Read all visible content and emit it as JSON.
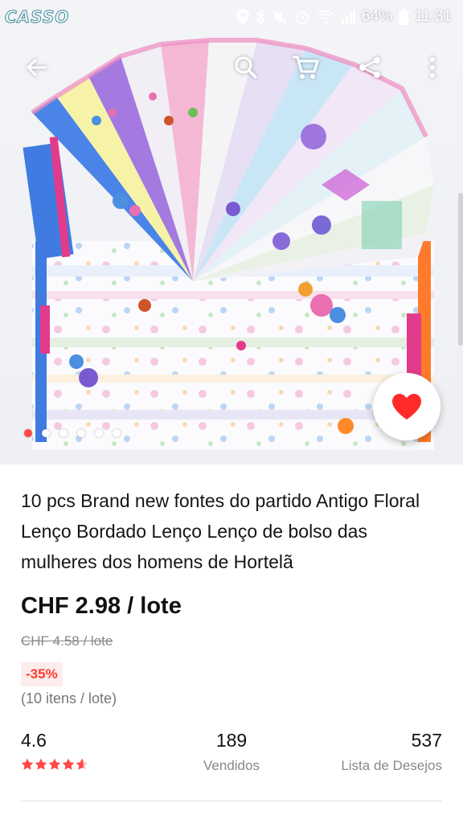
{
  "status_bar": {
    "carrier": "CASSO",
    "battery": "64%",
    "time": "11:31"
  },
  "toolbar": {
    "icons": [
      "back-arrow-icon",
      "search-icon",
      "cart-icon",
      "share-icon",
      "more-vert-icon"
    ]
  },
  "carousel": {
    "total": 6,
    "active_index": 0
  },
  "product": {
    "title": "10 pcs Brand new fontes do partido Antigo Floral Lenço Bordado Lenço Lenço de bolso das mulheres dos homens de Hortelã",
    "price": "CHF 2.98 / lote",
    "original_price": "CHF 4.58 / lote",
    "discount": "-35%",
    "lot_size": "(10 itens / lote)"
  },
  "stats": {
    "rating": "4.6",
    "rating_stars": 4.6,
    "sold_count": "189",
    "sold_label": "Vendidos",
    "wishlist_count": "537",
    "wishlist_label": "Lista de Desejos"
  },
  "colors": {
    "accent": "#ff4747",
    "discount_bg": "#fdecec",
    "star": "#ff4747"
  }
}
